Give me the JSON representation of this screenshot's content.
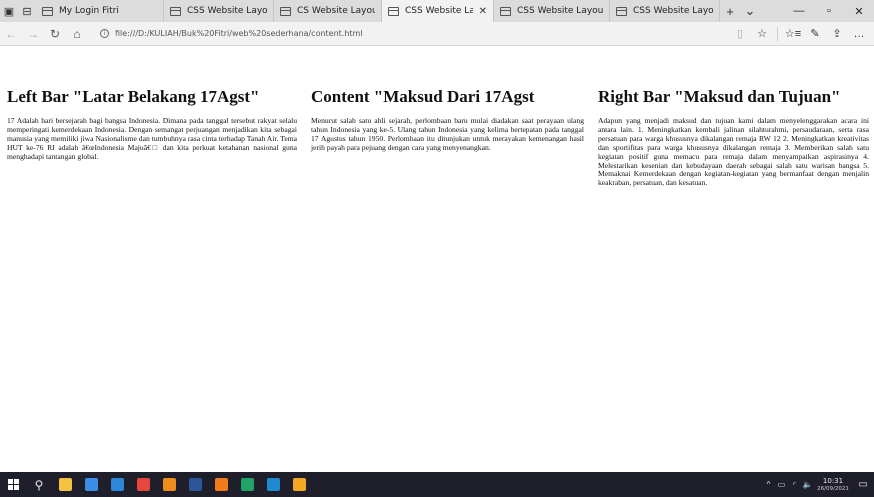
{
  "browser": {
    "tabs": [
      {
        "title": "My Login Fitri",
        "active": false
      },
      {
        "title": "CSS Website Layout",
        "active": false
      },
      {
        "title": "CS Website Layout",
        "active": false
      },
      {
        "title": "CSS Website Layou",
        "active": true,
        "close": "✕"
      },
      {
        "title": "CSS Website Layout",
        "active": false
      },
      {
        "title": "CSS Website Layout",
        "active": false
      }
    ],
    "new_tab": "+",
    "tab_menu": "⌄",
    "window_controls": {
      "minimize": "—",
      "maximize": "▫",
      "close": "✕"
    },
    "nav": {
      "back": "←",
      "forward": "→",
      "refresh": "↻",
      "home": "⌂"
    },
    "info_icon": "i",
    "url": "file:///D:/KULIAH/Buk%20Fitri/web%20sederhana/content.html",
    "toolbar": {
      "reading_view": "▯",
      "favorite": "☆",
      "favorites_bar": "☆≡",
      "pen": "✎",
      "share": "⇪",
      "more": "…"
    }
  },
  "page": {
    "left": {
      "heading": "Left Bar \"Latar Belakang 17Agst\"",
      "body": "17 Adalah hari bersejarah bagi bangsa Indonesia. Dimana pada tanggal tersebut rakyat selalu memperingati kemerdekaan Indonesia. Dengan semangat perjuangan menjadikan kita sebagai manusia yang memiliki jiwa Nasionalisme dan tumbuhnya rasa cinta terhadap Tanah Air. Tema HUT ke-76 RI adalah â€œIndonesia Majuâ€□ dan kita perkuat ketahanan nasional guna menghadapi tantangan global."
    },
    "content": {
      "heading": "Content \"Maksud Dari 17Agst",
      "body": "Menurut salah satu ahli sejarah, perlombaan baru mulai diadakan saat perayaan ulang tahun Indonesia yang ke-5. Ulang tahun Indonesia yang kelima bertepatan pada tanggal 17 Agustus tahun 1950. Perlombaan itu ditunjukan untuk merayakan kemenangan hasil jerih payah para pejuang dengan cara yang menyenangkan."
    },
    "right": {
      "heading": "Right Bar \"Maksud dan Tujuan\"",
      "body": "Adapun yang menjadi maksud dan tujuan kami dalam menyelenggarakan acara ini antara lain. 1. Meningkatkan kembali jalinan silahturahmi, persaudaraan, serta rasa persatuan para warga khususnya dikalangan remaja RW 12 2. Meningkatkan kreativitas dan sportifitas para warga khususnya dikalangan remaja 3. Memberikan salah satu kegiatan positif guna memacu para remaja dalam menyampaikan aspirasinya 4. Melestarikan kesenian dan kebudayaan daerah sebagai salah satu warisan bangsa 5. Memaknai Kemerdekaan dengan kegiatan-kegiatan yang bermanfaat dengan menjalin keakraban, persatuan, dan kesatuan."
    }
  },
  "taskbar": {
    "search_glyph": "⚲",
    "apps": [
      {
        "icon": "file-explorer-icon",
        "color": "#f5c242"
      },
      {
        "icon": "store-icon",
        "color": "#3a8ee6"
      },
      {
        "icon": "mail-icon",
        "color": "#2b88d8"
      },
      {
        "icon": "chrome-icon",
        "color": "#e8453c"
      },
      {
        "icon": "vlc-icon",
        "color": "#f08c1a"
      },
      {
        "icon": "word-icon",
        "color": "#2b579a"
      },
      {
        "icon": "sublime-icon",
        "color": "#f07c1a"
      },
      {
        "icon": "app-green-icon",
        "color": "#21a366"
      },
      {
        "icon": "edge-icon",
        "color": "#1f8ad2"
      },
      {
        "icon": "paint-icon",
        "color": "#f5a623"
      }
    ],
    "tray": {
      "chevron": "^",
      "battery": "▭",
      "wifi": "◜",
      "volume": "🔈",
      "time": "10:31",
      "date": "26/09/2021",
      "notifications": "▭"
    }
  }
}
